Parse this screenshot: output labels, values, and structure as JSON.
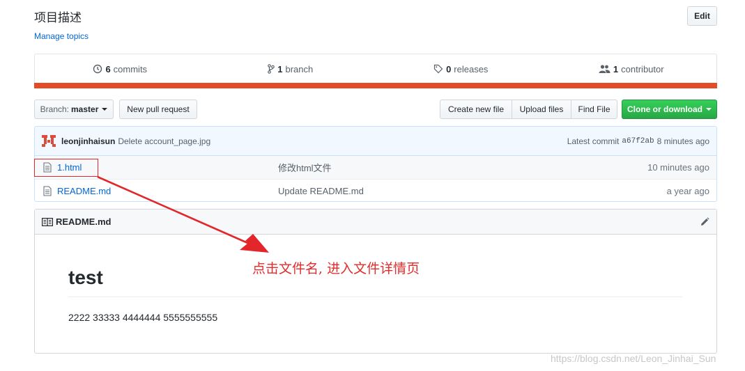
{
  "repo": {
    "description": "项目描述",
    "manage_topics": "Manage topics",
    "edit_label": "Edit"
  },
  "summary": {
    "commits_count": "6",
    "commits_label": "commits",
    "branch_count": "1",
    "branch_label": "branch",
    "releases_count": "0",
    "releases_label": "releases",
    "contributor_count": "1",
    "contributor_label": "contributor"
  },
  "language_bar_color": "#e34c26",
  "toolbar": {
    "branch_prefix": "Branch:",
    "branch_name": "master",
    "new_pr": "New pull request",
    "create_file": "Create new file",
    "upload_files": "Upload files",
    "find_file": "Find File",
    "clone": "Clone or download"
  },
  "latest_commit": {
    "author": "leonjinhaisun",
    "message": "Delete account_page.jpg",
    "latest_label": "Latest commit",
    "sha": "a67f2ab",
    "age": "8 minutes ago"
  },
  "files": [
    {
      "name": "1.html",
      "message": "修改html文件",
      "age": "10 minutes ago",
      "icon": "file-icon"
    },
    {
      "name": "README.md",
      "message": "Update README.md",
      "age": "a year ago",
      "icon": "file-icon"
    }
  ],
  "readme": {
    "filename": "README.md",
    "heading": "test",
    "body": "2222 33333 4444444 5555555555"
  },
  "annotation": {
    "text": "点击文件名, 进入文件详情页",
    "color": "#e3262a"
  },
  "watermark": "https://blog.csdn.net/Leon_Jinhai_Sun",
  "colors": {
    "link": "#0366d6",
    "clone_button": "#28a745"
  }
}
